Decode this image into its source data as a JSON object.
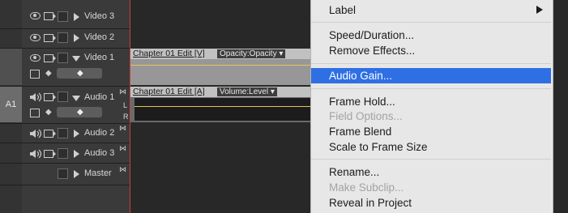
{
  "tracks": [
    {
      "id": "video3",
      "name": "Video 3",
      "kind": "video",
      "expanded": false
    },
    {
      "id": "video2",
      "name": "Video 2",
      "kind": "video",
      "expanded": false
    },
    {
      "id": "video1",
      "name": "Video 1",
      "kind": "video",
      "expanded": true
    },
    {
      "id": "audio1",
      "name": "Audio 1",
      "kind": "audio",
      "expanded": true,
      "target_label": "A1"
    },
    {
      "id": "audio2",
      "name": "Audio 2",
      "kind": "audio",
      "expanded": false
    },
    {
      "id": "audio3",
      "name": "Audio 3",
      "kind": "audio",
      "expanded": false
    },
    {
      "id": "master",
      "name": "Master",
      "kind": "master",
      "expanded": false
    }
  ],
  "clips": {
    "video": {
      "title": "Chapter 01 Edit [V]",
      "effect": "Opacity:Opacity"
    },
    "audio": {
      "title": "Chapter 01 Edit [A]",
      "effect": "Volume:Level"
    }
  },
  "channel_labels": {
    "left": "L",
    "right": "R"
  },
  "context_menu": {
    "label": "Label",
    "speed_duration": "Speed/Duration...",
    "remove_effects": "Remove Effects...",
    "audio_gain": "Audio Gain...",
    "frame_hold": "Frame Hold...",
    "field_options": "Field Options...",
    "frame_blend": "Frame Blend",
    "scale_to_frame_size": "Scale to Frame Size",
    "rename": "Rename...",
    "make_subclip": "Make Subclip...",
    "reveal_in_project": "Reveal in Project",
    "highlighted": "Audio Gain..."
  },
  "colors": {
    "highlight": "#2f6fe4",
    "playhead": "#d23a3a",
    "rubber_band": "#e6c35a"
  }
}
